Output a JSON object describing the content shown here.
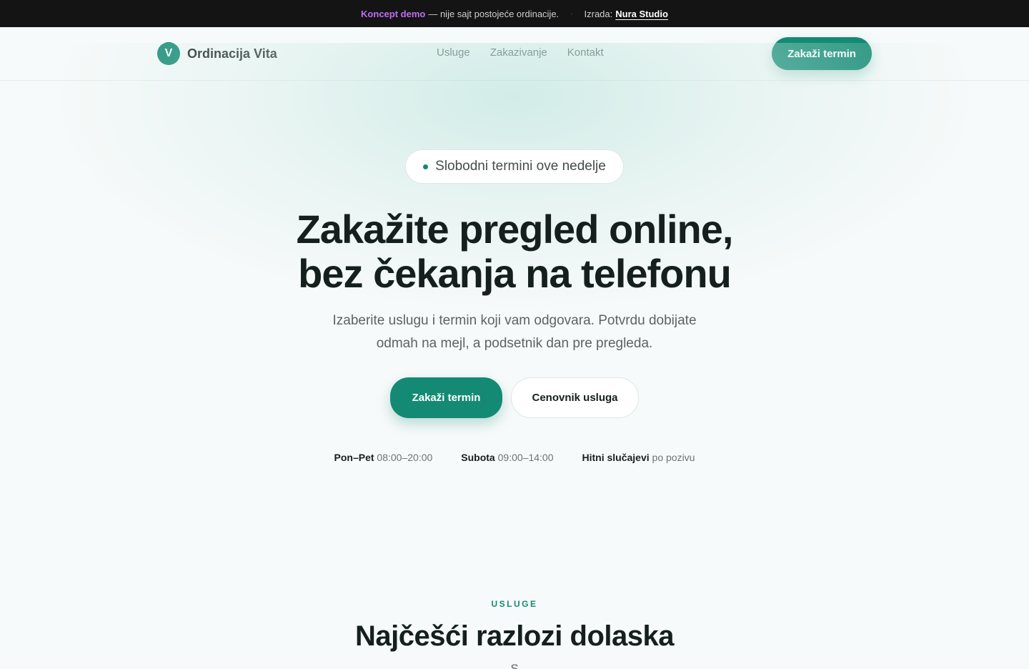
{
  "topbar": {
    "concept": "Koncept demo",
    "disclaimer": "— nije sajt postojeće ordinacije.",
    "separator": "·",
    "made_by_label": "Izrada:",
    "studio": "Nura Studio"
  },
  "header": {
    "logo_letter": "V",
    "brand": "Ordinacija Vita",
    "nav": [
      "Usluge",
      "Zakazivanje",
      "Kontakt"
    ],
    "cta": "Zakaži termin"
  },
  "hero": {
    "badge": "Slobodni termini ove nedelje",
    "title_line1": "Zakažite pregled online,",
    "title_line2": "bez čekanja na telefonu",
    "lede_line1": "Izaberite uslugu i termin koji vam odgovara. Potvrdu dobijate",
    "lede_line2": "odmah na mejl, a podsetnik dan pre pregleda.",
    "primary_cta": "Zakaži termin",
    "secondary_cta": "Cenovnik usluga",
    "hours": [
      {
        "label": "Pon–Pet",
        "value": "08:00–20:00"
      },
      {
        "label": "Subota",
        "value": "09:00–14:00"
      },
      {
        "label": "Hitni slučajevi",
        "value": "po pozivu"
      }
    ]
  },
  "services": {
    "eyebrow": "USLUGE",
    "title": "Najčešći razlozi dolaska",
    "subtitle": "S"
  },
  "colors": {
    "accent": "#148a74",
    "topbar_bg": "#141414",
    "concept": "#c26cf0"
  }
}
